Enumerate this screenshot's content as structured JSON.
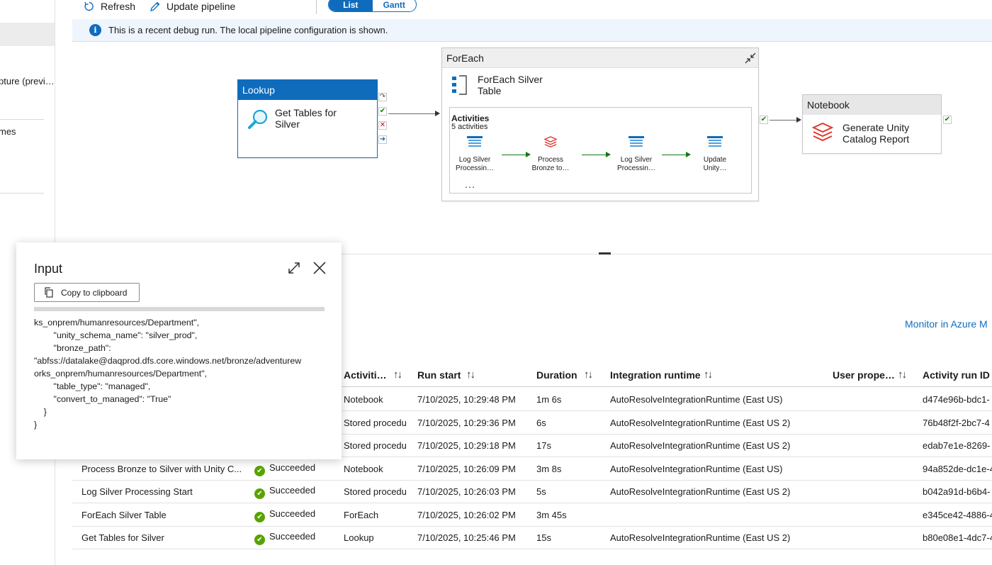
{
  "left_nav": {
    "items": [
      "pture (previ…",
      "mes"
    ]
  },
  "toolbar": {
    "refresh_label": "Refresh",
    "update_label": "Update pipeline",
    "view_toggle": [
      "List",
      "Gantt"
    ],
    "active_view": "List"
  },
  "banner": {
    "text": "This is a recent debug run. The local pipeline configuration is shown."
  },
  "canvas": {
    "lookup": {
      "type": "Lookup",
      "name_line1": "Get Tables for",
      "name_line2": "Silver"
    },
    "foreach": {
      "type": "ForEach",
      "name_line1": "ForEach Silver",
      "name_line2": "Table",
      "activities_title": "Activities",
      "activities_count": "5 activities",
      "mini_activities": [
        {
          "line1": "Log Silver",
          "line2": "Processin…"
        },
        {
          "line1": "Process",
          "line2": "Bronze to…"
        },
        {
          "line1": "Log Silver",
          "line2": "Processin…"
        },
        {
          "line1": "Update",
          "line2": "Unity…"
        }
      ],
      "more": "…"
    },
    "notebook": {
      "type": "Notebook",
      "name_line1": "Generate Unity",
      "name_line2": "Catalog Report"
    }
  },
  "monitor_link": "Monitor in Azure M",
  "table": {
    "columns": [
      "Activiti…",
      "Run start",
      "Duration",
      "Integration runtime",
      "User prope…",
      "Activity run ID"
    ],
    "rows": [
      {
        "name": "",
        "status": "",
        "type": "Notebook",
        "start": "7/10/2025, 10:29:48 PM",
        "duration": "1m 6s",
        "runtime": "AutoResolveIntegrationRuntime (East US)",
        "run_id": "d474e96b-bdc1-"
      },
      {
        "name": "",
        "status": "",
        "type": "Stored procedu",
        "start": "7/10/2025, 10:29:36 PM",
        "duration": "6s",
        "runtime": "AutoResolveIntegrationRuntime (East US 2)",
        "run_id": "76b48f2f-2bc7-4"
      },
      {
        "name": "",
        "status": "",
        "type": "Stored procedu",
        "start": "7/10/2025, 10:29:18 PM",
        "duration": "17s",
        "runtime": "AutoResolveIntegrationRuntime (East US 2)",
        "run_id": "edab7e1e-8269-"
      },
      {
        "name": "Process Bronze to Silver with Unity C...",
        "status": "Succeeded",
        "type": "Notebook",
        "start": "7/10/2025, 10:26:09 PM",
        "duration": "3m 8s",
        "runtime": "AutoResolveIntegrationRuntime (East US)",
        "run_id": "94a852de-dc1e-4"
      },
      {
        "name": "Log Silver Processing Start",
        "status": "Succeeded",
        "type": "Stored procedu",
        "start": "7/10/2025, 10:26:03 PM",
        "duration": "5s",
        "runtime": "AutoResolveIntegrationRuntime (East US 2)",
        "run_id": "b042a91d-b6b4-"
      },
      {
        "name": "ForEach Silver Table",
        "status": "Succeeded",
        "type": "ForEach",
        "start": "7/10/2025, 10:26:02 PM",
        "duration": "3m 45s",
        "runtime": "",
        "run_id": "e345ce42-4886-4"
      },
      {
        "name": "Get Tables for Silver",
        "status": "Succeeded",
        "type": "Lookup",
        "start": "7/10/2025, 10:25:46 PM",
        "duration": "15s",
        "runtime": "AutoResolveIntegrationRuntime (East US 2)",
        "run_id": "b80e08e1-4dc7-4"
      }
    ]
  },
  "dialog": {
    "title": "Input",
    "copy_label": "Copy to clipboard",
    "code": "ks_onprem/humanresources/Department\",\n        \"unity_schema_name\": \"silver_prod\",\n        \"bronze_path\":\n\"abfss://datalake@daqprod.dfs.core.windows.net/bronze/adventurew\norks_onprem/humanresources/Department\",\n        \"table_type\": \"managed\",\n        \"convert_to_managed\": \"True\"\n    }\n}"
  },
  "colors": {
    "accent": "#0f6cbd",
    "success": "#57a300",
    "error": "#c50f1f",
    "databricks": "#e2382c"
  }
}
